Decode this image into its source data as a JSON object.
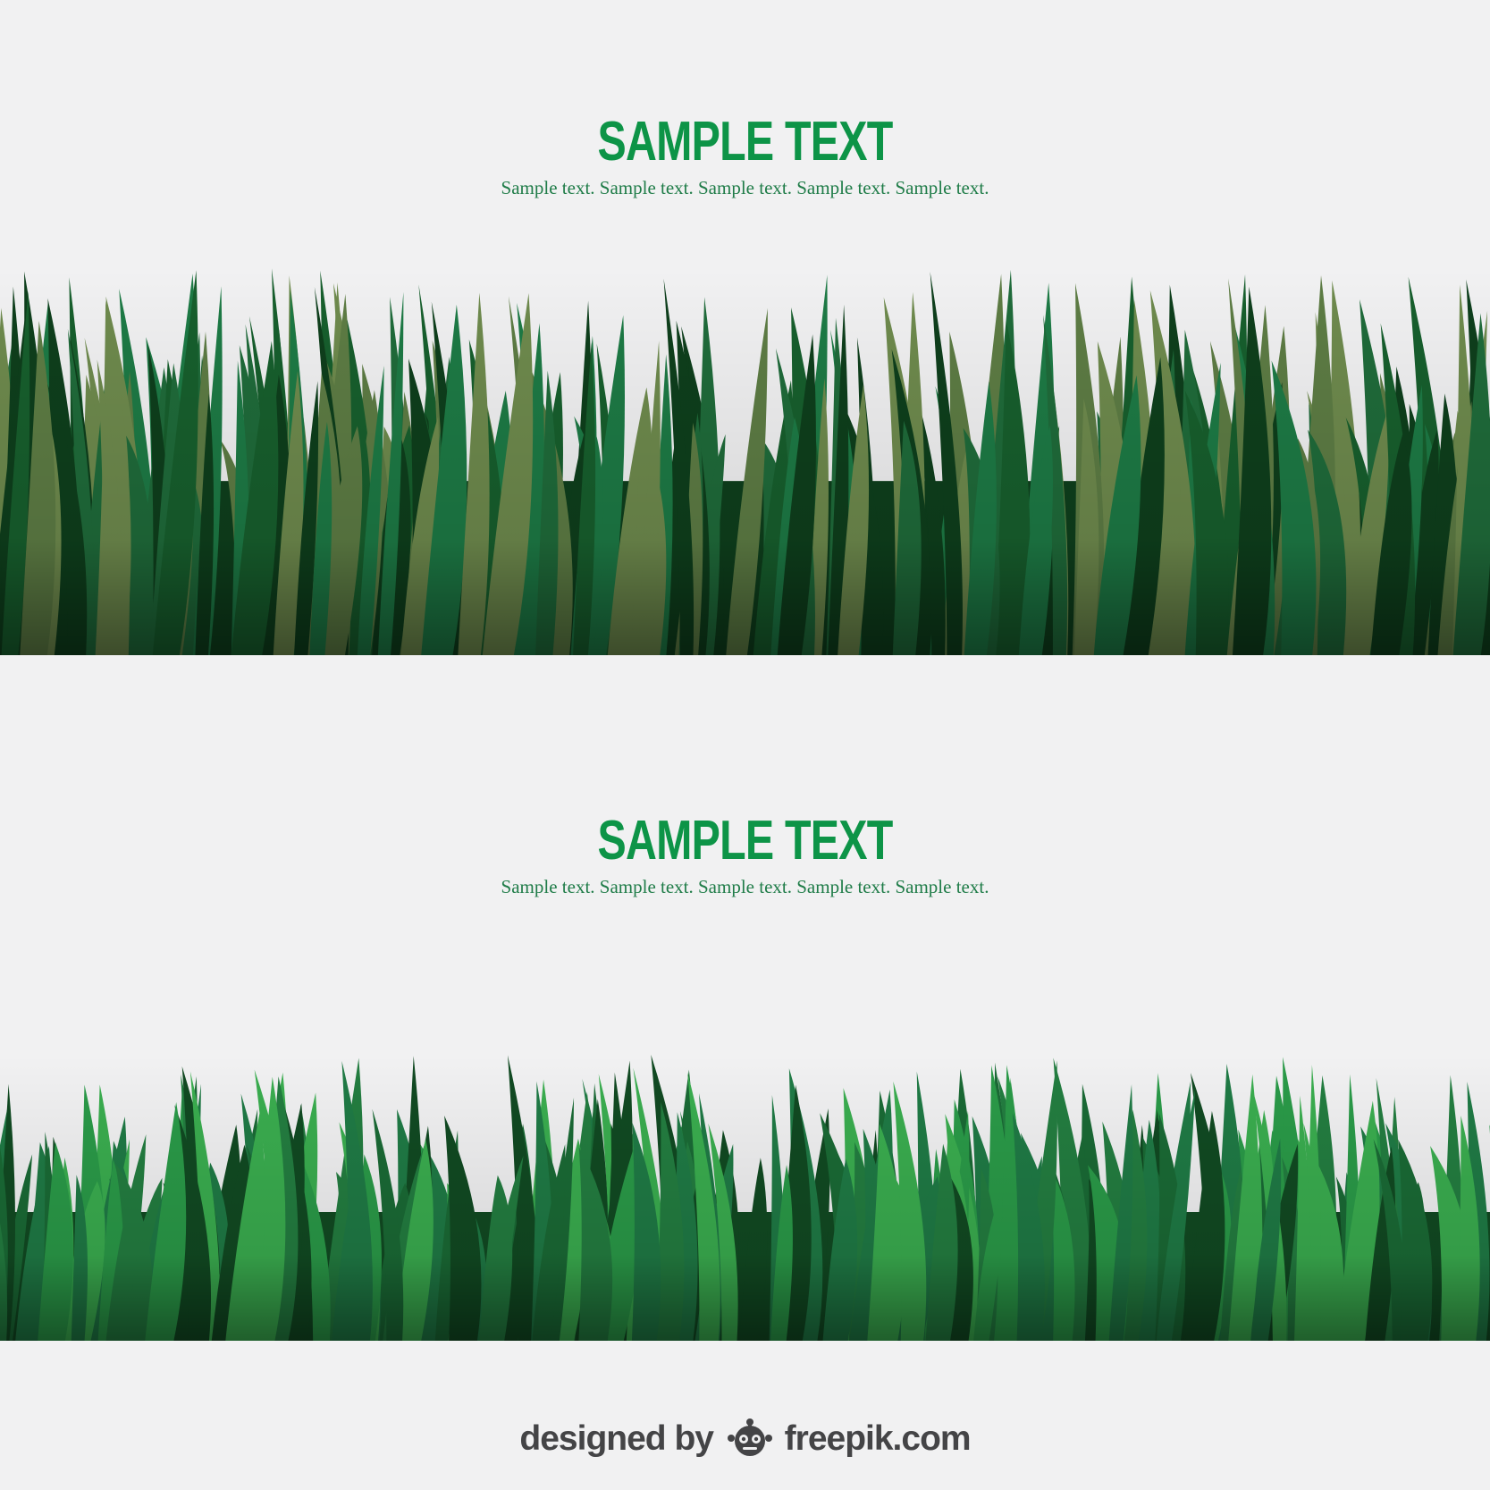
{
  "banners": [
    {
      "headline": "SAMPLE TEXT",
      "subline": "Sample text. Sample text. Sample text. Sample text. Sample text.",
      "grass_palette": [
        "#0e3f1c",
        "#175f2d",
        "#1d7a45",
        "#1f6b3a",
        "#5d7c44",
        "#6e8a4d"
      ]
    },
    {
      "headline": "SAMPLE TEXT",
      "subline": "Sample text. Sample text. Sample text. Sample text. Sample text.",
      "grass_palette": [
        "#114a22",
        "#1a6a35",
        "#1f7a45",
        "#2a9a48",
        "#3aad4f",
        "#237d40"
      ]
    }
  ],
  "footer": {
    "prefix": "designed by",
    "brand": "freepik.com",
    "icon": "freepik-logo-icon"
  },
  "colors": {
    "background": "#f1f1f2",
    "headline": "#0d9447",
    "subline": "#1f7c48",
    "footer_text": "#444446"
  }
}
